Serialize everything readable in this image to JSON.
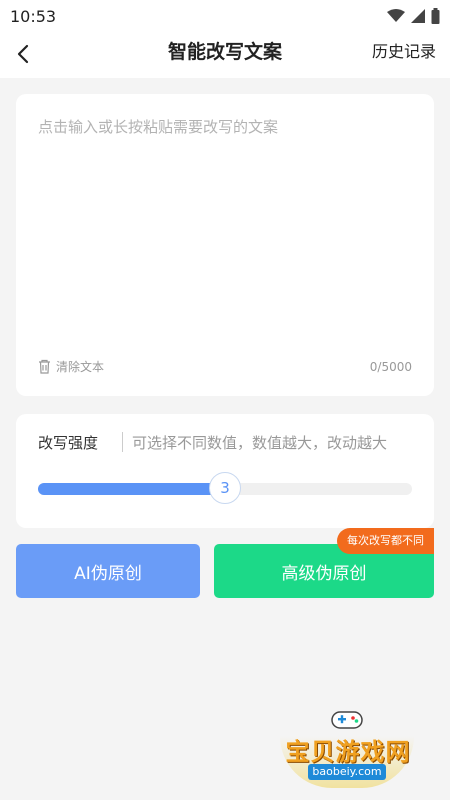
{
  "status_bar": {
    "time": "10:53"
  },
  "header": {
    "title": "智能改写文案",
    "history_label": "历史记录"
  },
  "input": {
    "placeholder": "点击输入或长按粘贴需要改写的文案",
    "clear_label": "清除文本",
    "char_count": "0/5000"
  },
  "strength": {
    "label": "改写强度",
    "hint": "可选择不同数值，数值越大，改动越大",
    "value": "3",
    "fill_fraction": 0.5
  },
  "actions": {
    "basic_label": "AI伪原创",
    "advanced_label": "高级伪原创",
    "promo_badge": "每次改写都不同"
  },
  "watermark": {
    "text": "宝贝游戏网",
    "url": "baobeiy.com"
  },
  "colors": {
    "accent": "#5a93f6",
    "green": "#1cd988",
    "orange": "#f26b1d"
  }
}
